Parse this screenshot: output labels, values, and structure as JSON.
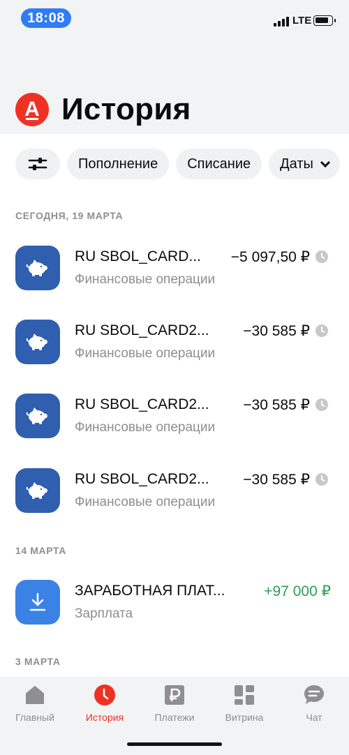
{
  "status_bar": {
    "time": "18:08",
    "network": "LTE"
  },
  "header": {
    "logo_letter": "А",
    "title": "История"
  },
  "filters": {
    "chips": [
      "Пополнение",
      "Списание",
      "Даты"
    ]
  },
  "sections": [
    {
      "label": "СЕГОДНЯ, 19 МАРТА"
    },
    {
      "label": "14 МАРТА"
    },
    {
      "label": "3 МАРТА"
    }
  ],
  "transactions": [
    {
      "name": "RU SBOL_CARD...",
      "category": "Финансовые операции",
      "amount": "−5 097,50 ₽",
      "icon": "piggy-bank-icon",
      "pending": true
    },
    {
      "name": "RU SBOL_CARD2...",
      "category": "Финансовые операции",
      "amount": "−30 585 ₽",
      "icon": "piggy-bank-icon",
      "pending": true
    },
    {
      "name": "RU SBOL_CARD2...",
      "category": "Финансовые операции",
      "amount": "−30 585 ₽",
      "icon": "piggy-bank-icon",
      "pending": true
    },
    {
      "name": "RU SBOL_CARD2...",
      "category": "Финансовые операции",
      "amount": "−30 585 ₽",
      "icon": "piggy-bank-icon",
      "pending": true
    },
    {
      "name": "ЗАРАБОТНАЯ ПЛАТ...",
      "category": "Зарплата",
      "amount": "+97 000 ₽",
      "icon": "download-icon",
      "pending": false
    }
  ],
  "tabbar": {
    "tabs": [
      {
        "label": "Главный",
        "icon": "home-icon"
      },
      {
        "label": "История",
        "icon": "history-clock-icon",
        "active": true
      },
      {
        "label": "Платежи",
        "icon": "ruble-icon"
      },
      {
        "label": "Витрина",
        "icon": "showcase-grid-icon"
      },
      {
        "label": "Чат",
        "icon": "chat-bubble-icon"
      }
    ]
  },
  "colors": {
    "brand_red": "#ef3124",
    "status_pill_blue": "#2f7cf6",
    "piggy_icon_bg": "#2f5fae",
    "salary_icon_bg": "#3a82e6",
    "income_green": "#2e9d55",
    "secondary_gray": "#8e8e93"
  }
}
